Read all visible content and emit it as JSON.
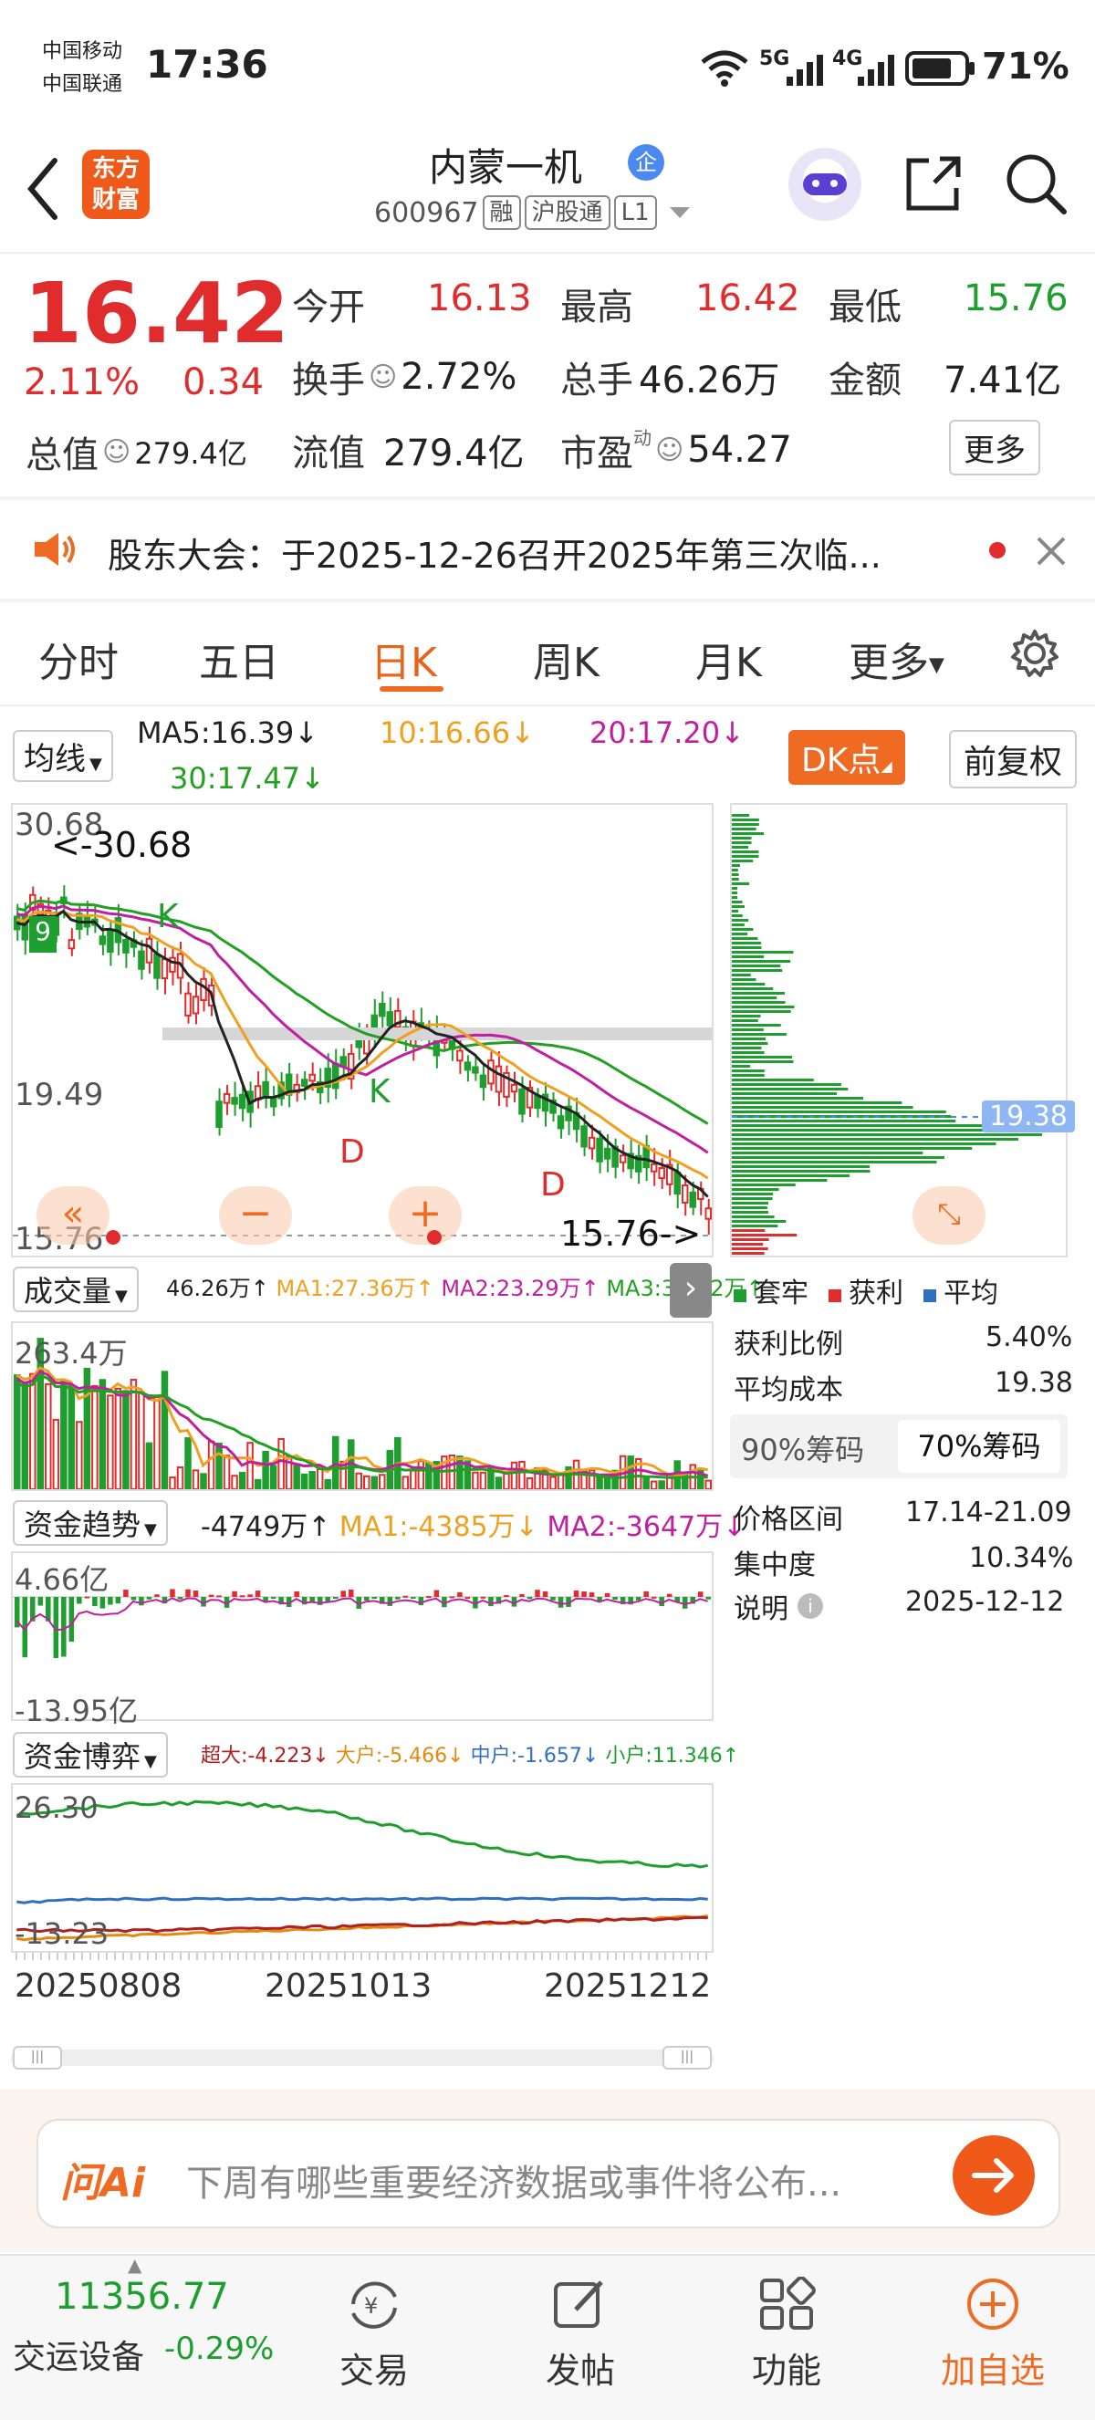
{
  "status": {
    "carrier1": "中国移动",
    "carrier2": "中国联通",
    "time": "17:36",
    "net1": "5G",
    "net2": "4G",
    "battery": "71%"
  },
  "header": {
    "brand_line1": "东方",
    "brand_line2": "财富",
    "name": "内蒙一机",
    "badge": "企",
    "code": "600967",
    "tags": [
      "融",
      "沪股通",
      "L1"
    ]
  },
  "quote": {
    "price": "16.42",
    "pct": "2.11%",
    "change": "0.34",
    "total_value_label": "总值",
    "total_value": "279.4亿",
    "open_label": "今开",
    "open": "16.13",
    "high_label": "最高",
    "high": "16.42",
    "low_label": "最低",
    "low": "15.76",
    "turnover_label": "换手",
    "turnover": "2.72%",
    "volume_label": "总手",
    "volume": "46.26万",
    "amount_label": "金额",
    "amount": "7.41亿",
    "float_label": "流值",
    "float": "279.4亿",
    "pe_label": "市盈",
    "pe_sup": "动",
    "pe": "54.27",
    "more_label": "更多"
  },
  "notice": {
    "text": "股东大会：于2025-12-26召开2025年第三次临..."
  },
  "tabs": [
    "分时",
    "五日",
    "日K",
    "周K",
    "月K",
    "更多"
  ],
  "active_tab": "日K",
  "ma": {
    "dropdown": "均线",
    "ma5": "MA5:16.39",
    "ma10": "10:16.66",
    "ma20": "20:17.20",
    "ma30": "30:17.47",
    "dk_label": "DK点",
    "fq_label": "前复权"
  },
  "kline": {
    "max_label": "30.68",
    "max_arrow": "<-30.68",
    "mid_label": "19.49",
    "min_label": "15.76",
    "min_arrow": "15.76->",
    "marks": [
      "9",
      "K",
      "D",
      "K",
      "D"
    ]
  },
  "volume": {
    "dropdown": "成交量",
    "value": "46.26万",
    "ma1": "MA1:27.36万",
    "ma2": "MA2:23.29万",
    "ma3": "MA3:34.92万",
    "axis_top": "263.4万"
  },
  "fund_trend": {
    "dropdown": "资金趋势",
    "value": "-4749万",
    "ma1": "MA1:-4385万",
    "ma2": "MA2:-3647万",
    "axis_top": "4.66亿",
    "axis_bottom": "-13.95亿"
  },
  "fund_game": {
    "dropdown": "资金博弈",
    "super": "超大:-4.223",
    "large": "大户:-5.466",
    "mid": "中户:-1.657",
    "small": "小户:11.346",
    "axis_top": "26.30",
    "axis_bottom": "-13.23"
  },
  "dates": [
    "20250808",
    "20251013",
    "20251212"
  ],
  "chips": {
    "avg_price_tag": "19.38",
    "legend_trapped": "套牢",
    "legend_profit": "获利",
    "legend_avg": "平均",
    "profit_ratio_label": "获利比例",
    "profit_ratio": "5.40%",
    "avg_cost_label": "平均成本",
    "avg_cost": "19.38",
    "tab90": "90%筹码",
    "tab70": "70%筹码",
    "range_label": "价格区间",
    "range": "17.14-21.09",
    "concentration_label": "集中度",
    "concentration": "10.34%",
    "note_label": "说明",
    "note_date": "2025-12-12"
  },
  "ai": {
    "logo": "问Ai",
    "placeholder": "下周有哪些重要经济数据或事件将公布..."
  },
  "bottom": {
    "index_value": "11356.77",
    "index_name": "交运设备",
    "index_pct": "-0.29%",
    "nav": [
      "交易",
      "发帖",
      "功能",
      "加自选"
    ]
  },
  "colors": {
    "up": "#e02c2c",
    "down": "#1e9e2e",
    "accent": "#ef6a22",
    "ma5": "#222222",
    "ma10": "#f0a020",
    "ma20": "#c020a0",
    "ma30": "#22a022"
  }
}
